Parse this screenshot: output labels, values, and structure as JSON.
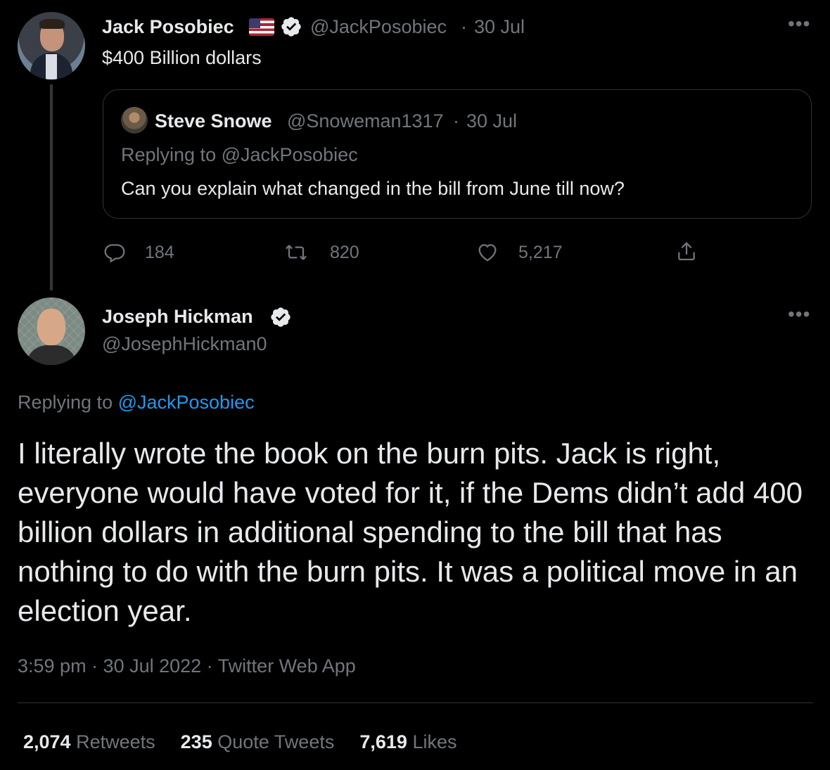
{
  "original_tweet": {
    "author_name": "Jack Posobiec",
    "handle": "@JackPosobiec",
    "separator": "·",
    "date": "30 Jul",
    "text": "$400 Billion dollars",
    "more": "•••",
    "quoted": {
      "author_name": "Steve Snowe",
      "handle": "@Snoweman1317",
      "separator": "·",
      "date": "30 Jul",
      "replying_prefix": "Replying to ",
      "replying_handle": "@JackPosobiec",
      "text": "Can you explain what changed in the bill from June till now?"
    },
    "actions": {
      "replies": "184",
      "retweets": "820",
      "likes": "5,217"
    }
  },
  "main_tweet": {
    "author_name": "Joseph Hickman",
    "handle": "@JosephHickman0",
    "more": "•••",
    "replying_prefix": "Replying to ",
    "replying_handle": "@JackPosobiec",
    "text": "I literally wrote the book on the burn pits. Jack is right, everyone would have voted for it, if the Dems didn’t add 400 billion dollars in additional spending to the bill that has nothing to do with the burn pits. It was a political move in an election year.",
    "meta": "3:59 pm · 30 Jul 2022 · Twitter Web App",
    "stats": {
      "retweets_count": "2,074",
      "retweets_label": "Retweets",
      "quotes_count": "235",
      "quotes_label": "Quote Tweets",
      "likes_count": "7,619",
      "likes_label": "Likes"
    }
  },
  "colors": {
    "background": "#000000",
    "text": "#e7e9ea",
    "muted": "#71767b",
    "link": "#1d9bf0",
    "border": "#2f3336",
    "verified": "#e7e9ea"
  },
  "icons": [
    "flag-icon",
    "verified-badge-icon",
    "reply-icon",
    "retweet-icon",
    "like-icon",
    "share-icon",
    "more-icon"
  ]
}
